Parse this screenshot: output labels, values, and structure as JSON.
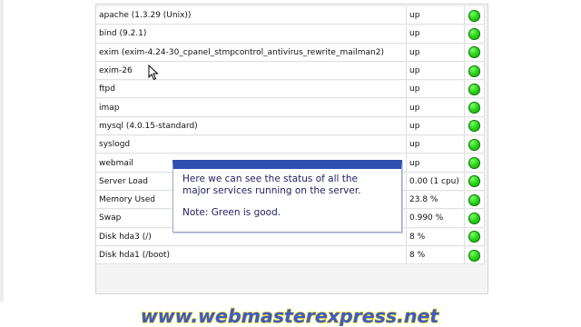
{
  "services": [
    {
      "name": "apache (1.3.29 (Unix))",
      "status": "up",
      "light": "green"
    },
    {
      "name": "bind (9.2.1)",
      "status": "up",
      "light": "green"
    },
    {
      "name": "exim (exim-4.24-30_cpanel_stmpcontrol_antivirus_rewrite_mailman2)",
      "status": "up",
      "light": "green"
    },
    {
      "name": "exim-26",
      "status": "up",
      "light": "green"
    },
    {
      "name": "ftpd",
      "status": "up",
      "light": "green"
    },
    {
      "name": "imap",
      "status": "up",
      "light": "green"
    },
    {
      "name": "mysql (4.0.15-standard)",
      "status": "up",
      "light": "green"
    },
    {
      "name": "syslogd",
      "status": "up",
      "light": "green"
    },
    {
      "name": "webmail",
      "status": "up",
      "light": "green"
    },
    {
      "name": "Server Load",
      "status": "0.00 (1 cpu)",
      "light": "green"
    },
    {
      "name": "Memory Used",
      "status": "23.8 %",
      "light": "green"
    },
    {
      "name": "Swap",
      "status": "0.990 %",
      "light": "green"
    },
    {
      "name": "Disk hda3 (/)",
      "status": "8 %",
      "light": "green"
    },
    {
      "name": "Disk hda1 (/boot)",
      "status": "8 %",
      "light": "green"
    }
  ],
  "tooltip": {
    "line1": "Here we can see the status of all the",
    "line2": "major services running on the server.",
    "note": "Note: Green is good."
  },
  "watermark": {
    "text": "www.webmasterexpress.net"
  },
  "colors": {
    "status_up": "#22c814",
    "tooltip_bar": "#2f4fb3",
    "watermark_fill": "#3b5cc9",
    "watermark_outline": "#f2d400"
  },
  "icons": {
    "status_light": "green-circle-icon",
    "cursor": "mouse-pointer-icon"
  }
}
